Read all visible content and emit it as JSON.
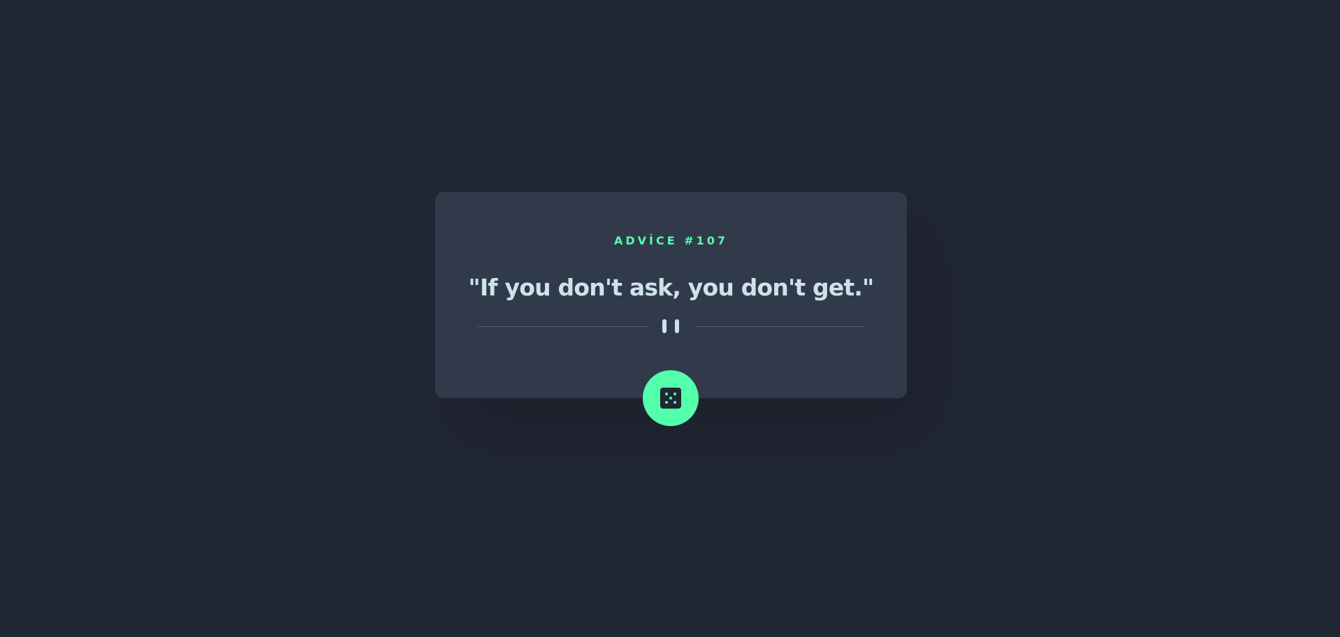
{
  "advice": {
    "label": "ADVİCE #107",
    "quote": "\"If you don't ask, you don't get.\""
  },
  "divider": {
    "icon": "pause-icon"
  },
  "dice_button": {
    "icon": "dice-icon"
  },
  "colors": {
    "background": "#202632",
    "card": "#313a4a",
    "accent": "#53ffaa",
    "text": "#cee3e9",
    "divider": "#4f5d74"
  }
}
